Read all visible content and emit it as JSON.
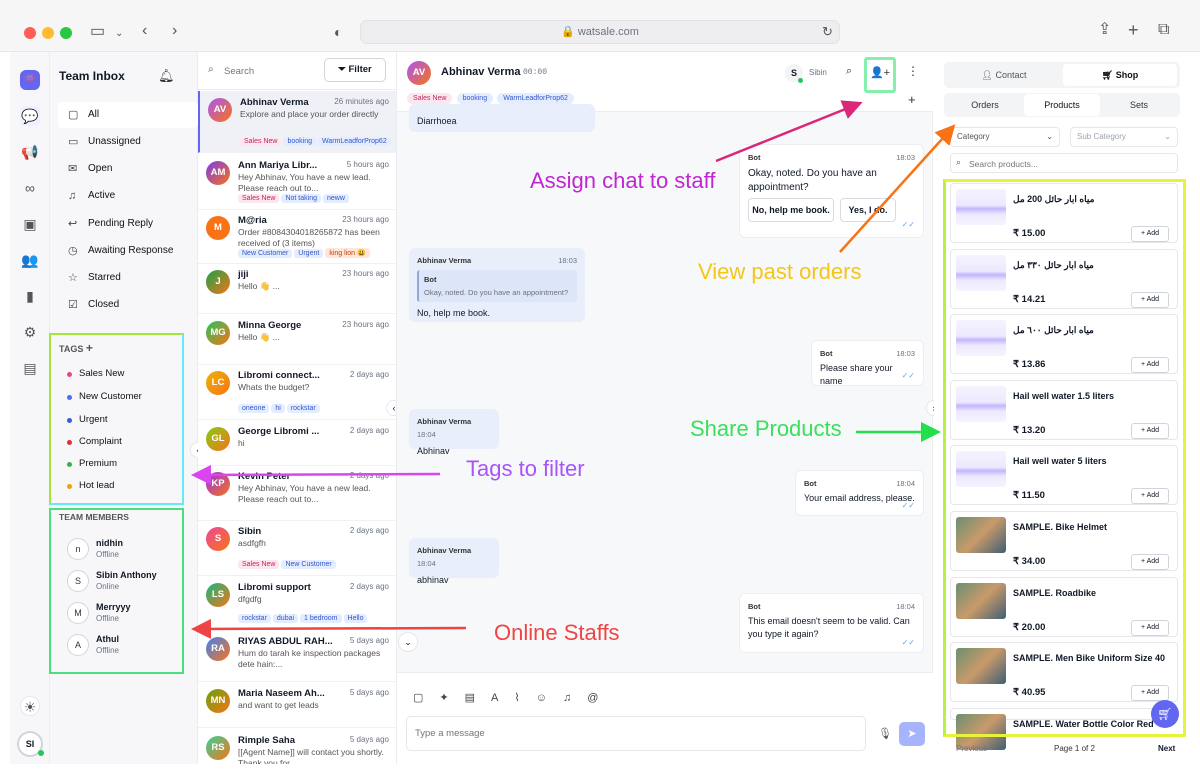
{
  "browser": {
    "url": "watsale.com"
  },
  "sidebar": {
    "title": "Team Inbox",
    "nav": [
      {
        "label": "All",
        "icon": "chat-icon"
      },
      {
        "label": "Unassigned",
        "icon": "inbox-icon"
      },
      {
        "label": "Open",
        "icon": "envelope-icon"
      },
      {
        "label": "Active",
        "icon": "bell-icon"
      },
      {
        "label": "Pending Reply",
        "icon": "reply-icon"
      },
      {
        "label": "Awaiting Response",
        "icon": "clock-icon"
      },
      {
        "label": "Starred",
        "icon": "star-icon"
      },
      {
        "label": "Closed",
        "icon": "check-square-icon"
      }
    ],
    "tags_title": "TAGS",
    "tags": [
      {
        "label": "Sales New",
        "color": "#e64980"
      },
      {
        "label": "New Customer",
        "color": "#4c6ef5"
      },
      {
        "label": "Urgent",
        "color": "#3b5bdb"
      },
      {
        "label": "Complaint",
        "color": "#e03131"
      },
      {
        "label": "Premium",
        "color": "#37b24d"
      },
      {
        "label": "Hot lead",
        "color": "#f59f00"
      }
    ],
    "members_title": "TEAM MEMBERS",
    "members": [
      {
        "initial": "n",
        "name": "nidhin",
        "status": "Offline"
      },
      {
        "initial": "S",
        "name": "Sibin Anthony",
        "status": "Online"
      },
      {
        "initial": "M",
        "name": "Merryyy",
        "status": "Offline"
      },
      {
        "initial": "A",
        "name": "Athul",
        "status": "Offline"
      }
    ],
    "user_initials": "SI"
  },
  "chatlist": {
    "search_placeholder": "Search",
    "filter_label": "Filter",
    "chats": [
      {
        "initials": "AV",
        "name": "Abhinav Verma",
        "time": "26 minutes ago",
        "preview": "Explore and place your order directly",
        "tags": [
          "Sales New",
          "booking",
          "WarmLeadforProp62"
        ],
        "color": "#a855f7"
      },
      {
        "initials": "AM",
        "name": "Ann Mariya Libr...",
        "time": "5 hours ago",
        "preview": "Hey Abhinav, You have a new lead. Please reach out to...",
        "tags": [
          "Sales New",
          "Not taking",
          "neww"
        ],
        "color": "#7c3aed"
      },
      {
        "initials": "M",
        "name": "M@ria",
        "time": "23 hours ago",
        "preview": "Order #8084304018265872 has been received of (3 items)",
        "tags": [
          "New Customer",
          "Urgent",
          "king lion 😃"
        ],
        "color": "#f97316"
      },
      {
        "initials": "J",
        "name": "jiji",
        "time": "23 hours ago",
        "preview": "Hello 👋 ...",
        "tags": [],
        "color": "#16a34a"
      },
      {
        "initials": "MG",
        "name": "Minna George",
        "time": "23 hours ago",
        "preview": "Hello 👋 ...",
        "tags": [],
        "color": "#22c55e"
      },
      {
        "initials": "LC",
        "name": "Libromi connect...",
        "time": "2 days ago",
        "preview": "Whats the budget?",
        "tags": [
          "oneone",
          "hi",
          "rockstar"
        ],
        "color": "#eab308"
      },
      {
        "initials": "GL",
        "name": "George Libromi ...",
        "time": "2 days ago",
        "preview": "hi",
        "tags": [],
        "color": "#84cc16"
      },
      {
        "initials": "KP",
        "name": "Kevin Peter",
        "time": "2 days ago",
        "preview": "Hey Abhinav, You have a new lead. Please reach out to...",
        "tags": [],
        "color": "#9333ea"
      },
      {
        "initials": "S",
        "name": "Sibin",
        "time": "2 days ago",
        "preview": "asdfgfh",
        "tags": [
          "Sales New",
          "New Customer"
        ],
        "color": "#ec4899"
      },
      {
        "initials": "LS",
        "name": "Libromi support",
        "time": "2 days ago",
        "preview": "dfgdfg",
        "tags": [
          "rockstar",
          "dubai",
          "1 bedroom",
          "Hello"
        ],
        "color": "#10b981"
      },
      {
        "initials": "RA",
        "name": "RIYAS ABDUL RAH...",
        "time": "5 days ago",
        "preview": "Hum do tarah ke inspection packages dete hain:...",
        "tags": [],
        "color": "#3b82f6"
      },
      {
        "initials": "MN",
        "name": "Maria Naseem Ah...",
        "time": "5 days ago",
        "preview": "and want to get leads",
        "tags": [],
        "color": "#65a30d"
      },
      {
        "initials": "RS",
        "name": "Rimple Saha",
        "time": "5 days ago",
        "preview": "[[Agent Name]] will contact you shortly. Thank you for...",
        "tags": [],
        "color": "#34d399"
      }
    ]
  },
  "conversation": {
    "contact_initials": "AV",
    "contact_name": "Abhinav Verma",
    "timer": "00:00",
    "agent_initial": "S",
    "agent_name": "Sibin",
    "tags": [
      "Sales New",
      "booking",
      "WarmLeadforProp62"
    ],
    "messages": {
      "m0": {
        "text": "Diarrhoea"
      },
      "m1": {
        "sender": "Bot",
        "time": "18:03",
        "text": "Okay, noted. Do you have an appointment?",
        "btn1": "No, help me book.",
        "btn2": "Yes, I do."
      },
      "m2": {
        "sender": "Abhinav Verma",
        "time": "18:03",
        "quote_sender": "Bot",
        "quote_text": "Okay, noted. Do you have an appointment?",
        "text": "No, help me book."
      },
      "m3": {
        "sender": "Bot",
        "time": "18:03",
        "text": "Please share your name"
      },
      "m4": {
        "sender": "Abhinav Verma",
        "time": "18:04",
        "text": "Abhinav"
      },
      "m5": {
        "sender": "Bot",
        "time": "18:04",
        "text": "Your email address, please."
      },
      "m6": {
        "sender": "Abhinav Verma",
        "time": "18:04",
        "text": "abhinav"
      },
      "m7": {
        "sender": "Bot",
        "time": "18:04",
        "text": "This email doesn't seem to be valid. Can you type it again?"
      }
    },
    "composer_placeholder": "Type a message"
  },
  "rpanel": {
    "tab_contact": "Contact",
    "tab_shop": "Shop",
    "sub_orders": "Orders",
    "sub_products": "Products",
    "sub_sets": "Sets",
    "category_placeholder": "Category",
    "subcategory_placeholder": "Sub Category",
    "search_placeholder": "Search products...",
    "add_label": "Add",
    "products": [
      {
        "name": "مياه ابار حائل 200 مل",
        "price": "₹ 15.00",
        "img": "water"
      },
      {
        "name": "مياه ابار حائل ٣٣٠ مل",
        "price": "₹ 14.21",
        "img": "water"
      },
      {
        "name": "مياه ابار حائل ٦٠٠ مل",
        "price": "₹ 13.86",
        "img": "water"
      },
      {
        "name": "Hail well water 1.5 liters",
        "price": "₹ 13.20",
        "img": "water"
      },
      {
        "name": "Hail well water 5 liters",
        "price": "₹ 11.50",
        "img": "water"
      },
      {
        "name": "SAMPLE. Bike Helmet",
        "price": "₹ 34.00",
        "img": "photo"
      },
      {
        "name": "SAMPLE. Roadbike",
        "price": "₹ 20.00",
        "img": "photo"
      },
      {
        "name": "SAMPLE. Men Bike Uniform Size 40",
        "price": "₹ 40.95",
        "img": "photo"
      },
      {
        "name": "SAMPLE. Water Bottle Color Red",
        "price": "",
        "img": "photo"
      }
    ],
    "prev_label": "Previous",
    "page_label": "Page 1 of 2",
    "next_label": "Next"
  },
  "annotations": {
    "assign": "Assign chat to staff",
    "orders": "View past orders",
    "share": "Share Products",
    "tags": "Tags to filter",
    "staffs": "Online Staffs"
  },
  "colors": {
    "accent": "#6366f1",
    "assign": "#c026d3",
    "orders": "#f5c518",
    "share": "#39e05a",
    "tags": "#a855f7",
    "staffs": "#ef4444"
  }
}
